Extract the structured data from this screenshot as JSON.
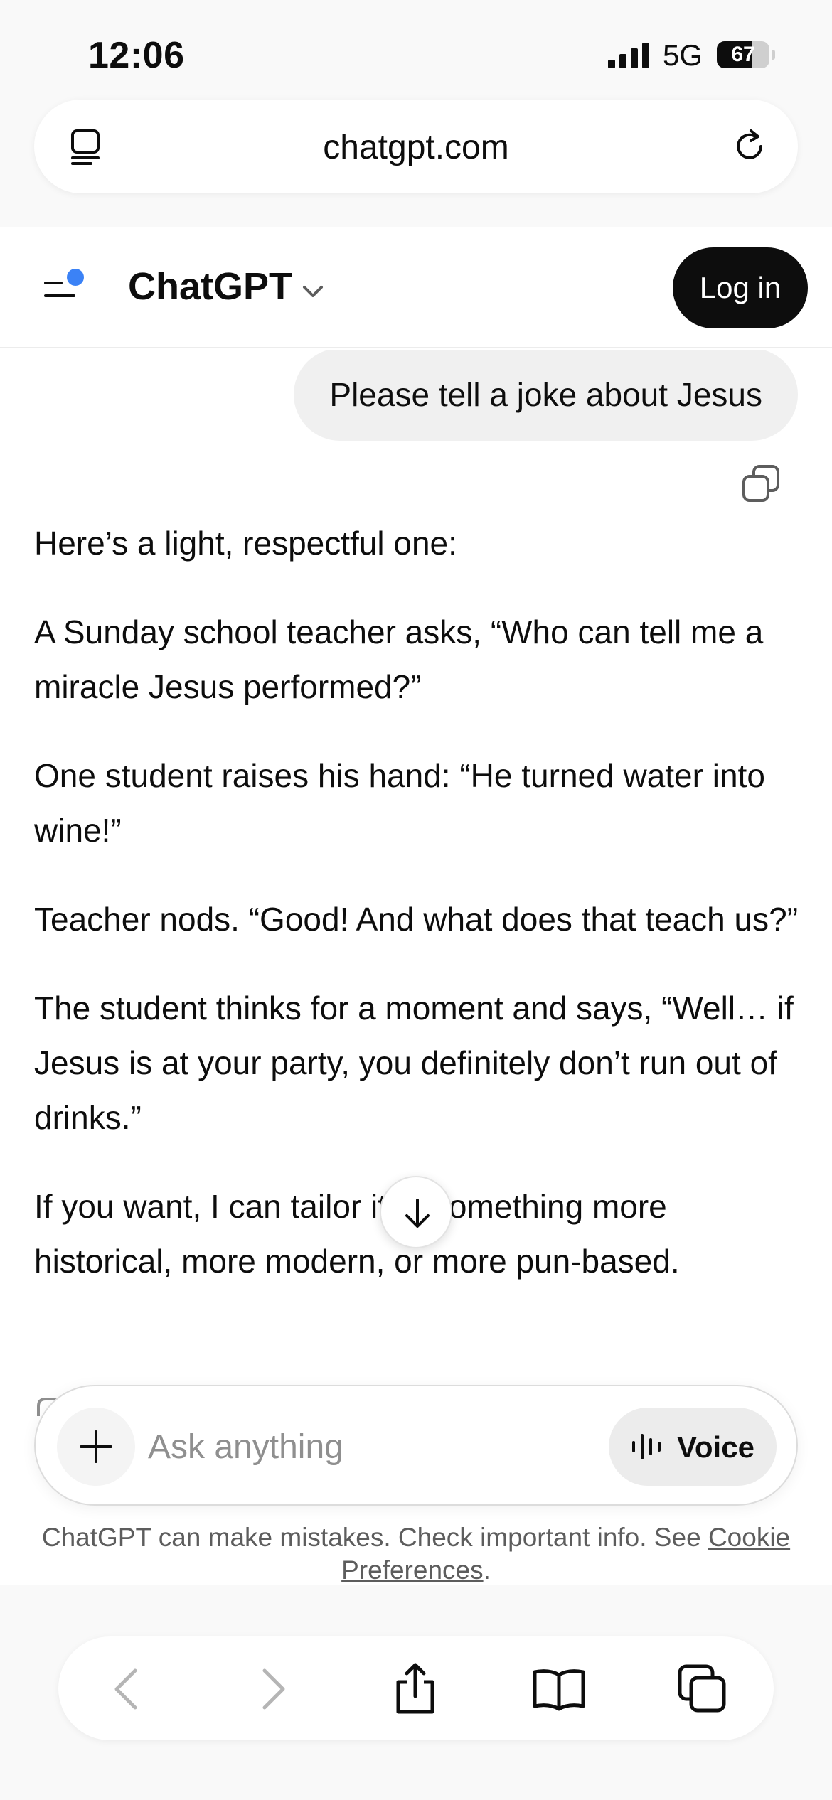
{
  "status_bar": {
    "time": "12:06",
    "network": "5G",
    "battery_percent": "67",
    "battery_level": 0.67
  },
  "browser": {
    "url": "chatgpt.com",
    "left_icon": "tabs-overview-icon",
    "right_icon": "reload-icon"
  },
  "app_header": {
    "title": "ChatGPT",
    "login_label": "Log in",
    "accent_color": "#3b82f6"
  },
  "conversation": {
    "user_message": "Please tell a joke about Jesus",
    "assistant_paragraphs": [
      "Here’s a light, respectful one:",
      "A Sunday school teacher asks, “Who can tell me a miracle Jesus performed?”",
      "One student raises his hand: “He turned water into wine!”",
      "Teacher nods. “Good! And what does that teach us?”",
      "The student thinks for a moment and says, “Well… if Jesus is at your party, you definitely don’t run out of drinks.”",
      "If you want, I can tailor it to something more historical, more modern, or more pun-based."
    ]
  },
  "composer": {
    "placeholder": "Ask anything",
    "value": "",
    "voice_label": "Voice"
  },
  "disclaimer": {
    "text": "ChatGPT can make mistakes. Check important info. See ",
    "link_text": "Cookie Preferences",
    "suffix": "."
  },
  "toolbar": {
    "items": [
      "back",
      "forward",
      "share",
      "bookmarks",
      "tabs"
    ]
  }
}
